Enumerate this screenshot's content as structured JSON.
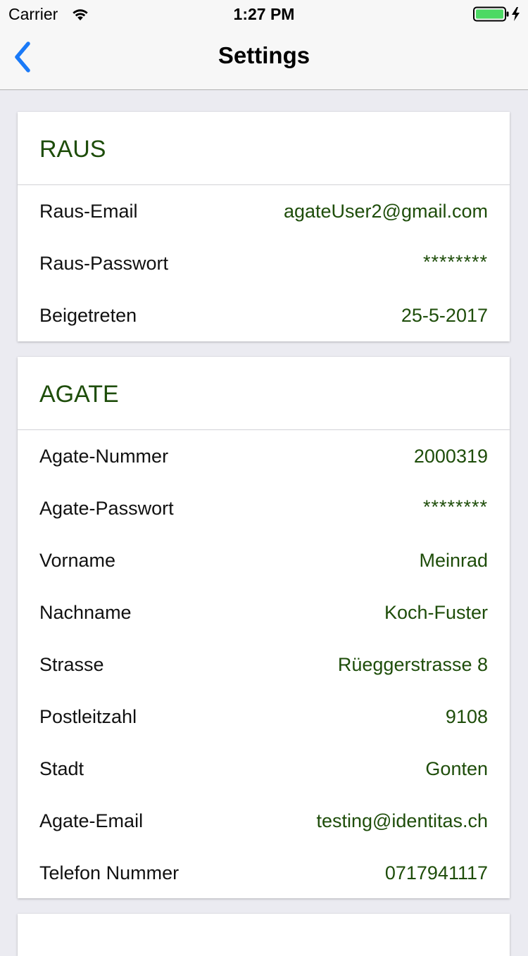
{
  "status_bar": {
    "carrier": "Carrier",
    "time": "1:27 PM"
  },
  "nav": {
    "title": "Settings",
    "back_icon": "chevron-left-icon"
  },
  "colors": {
    "accent": "#1a7af8",
    "section_green": "#1e4d0a",
    "battery_green": "#4cd964"
  },
  "sections": [
    {
      "title": "RAUS",
      "rows": [
        {
          "label": "Raus-Email",
          "value": "agateUser2@gmail.com"
        },
        {
          "label": "Raus-Passwort",
          "value": "********"
        },
        {
          "label": "Beigetreten",
          "value": "25-5-2017"
        }
      ]
    },
    {
      "title": "AGATE",
      "rows": [
        {
          "label": "Agate-Nummer",
          "value": "2000319"
        },
        {
          "label": "Agate-Passwort",
          "value": "********"
        },
        {
          "label": "Vorname",
          "value": "Meinrad"
        },
        {
          "label": "Nachname",
          "value": "Koch-Fuster"
        },
        {
          "label": "Strasse",
          "value": "Rüeggerstrasse 8"
        },
        {
          "label": "Postleitzahl",
          "value": "9108"
        },
        {
          "label": "Stadt",
          "value": "Gonten"
        },
        {
          "label": "Agate-Email",
          "value": "testing@identitas.ch"
        },
        {
          "label": "Telefon Nummer",
          "value": "0717941117"
        }
      ]
    }
  ]
}
